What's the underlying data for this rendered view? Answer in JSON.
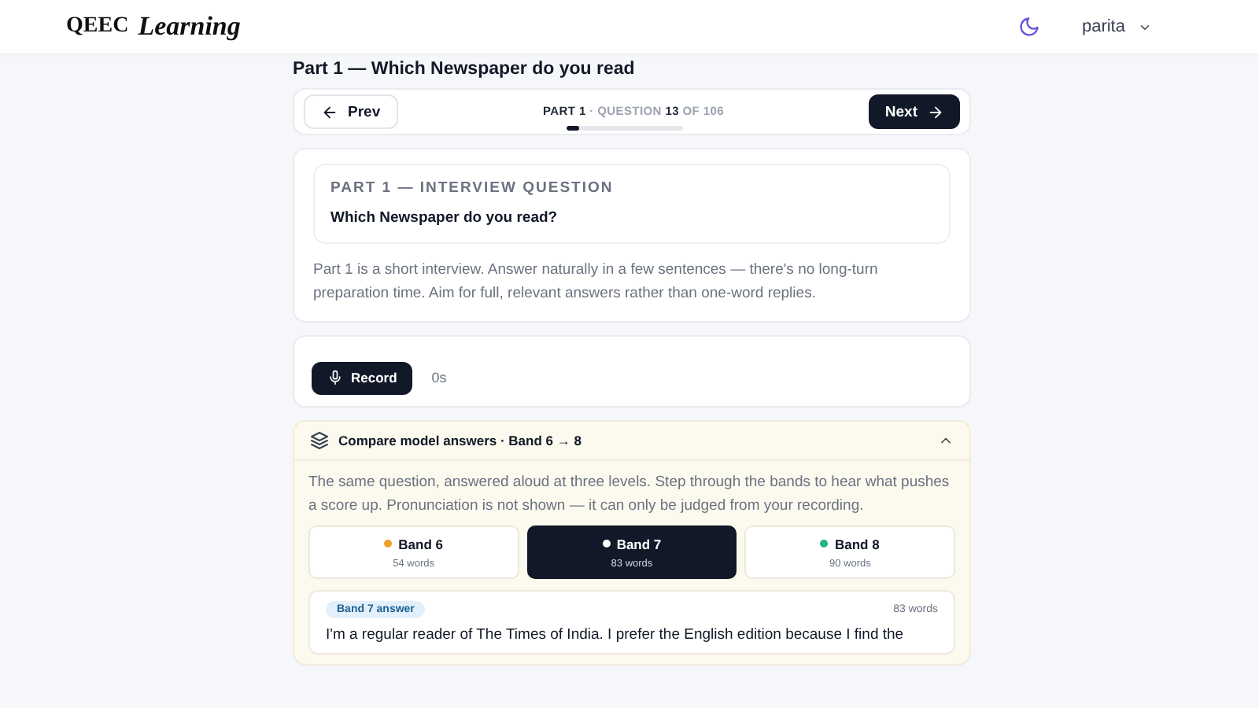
{
  "header": {
    "logo_mark": "QEEC",
    "logo_text": "Learning",
    "user": "parita"
  },
  "page_title": "Part 1 — Which Newspaper do you read",
  "nav": {
    "prev": "Prev",
    "next": "Next",
    "part": "PART 1",
    "question_label": "· QUESTION",
    "current": "13",
    "of": "OF",
    "total": "106",
    "level": 0.12
  },
  "question": {
    "eyebrow": "PART 1 — INTERVIEW QUESTION",
    "text": "Which Newspaper do you read?",
    "note": "Part 1 is a short interview. Answer naturally in a few sentences — there's no long-turn preparation time. Aim for full, relevant answers rather than one-word replies."
  },
  "recorder": {
    "button": "Record",
    "elapsed": "0s"
  },
  "compare": {
    "title": "Compare model answers · Band 6 → 8",
    "expanded": true,
    "intro": "The same question, answered aloud at three levels. Step through the bands to hear what pushes a score up. Pronunciation is not shown — it can only be judged from your recording.",
    "bands": [
      {
        "label": "Band 6",
        "words": "54 words",
        "color": "#f0a12b",
        "selected": false
      },
      {
        "label": "Band 7",
        "words": "83 words",
        "color": "#ffffff",
        "selected": true
      },
      {
        "label": "Band 8",
        "words": "90 words",
        "color": "#1fb57f",
        "selected": false
      }
    ],
    "answer": {
      "tag": "Band 7 answer",
      "words": "83 words",
      "text": "I'm a regular reader of The Times of India. I prefer the English edition because I find the"
    }
  }
}
